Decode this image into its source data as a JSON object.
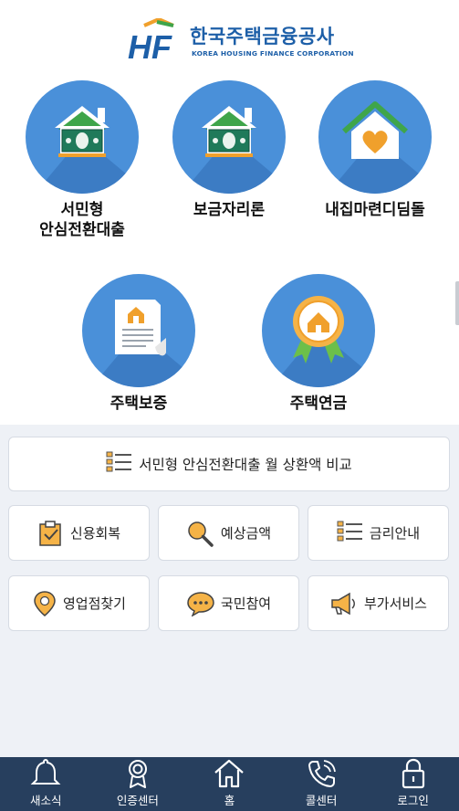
{
  "header": {
    "logo_mark": "HF",
    "logo_korean": "한국주택금융공사",
    "logo_english": "KOREA HOUSING FINANCE CORPORATION",
    "brand_blue": "#1d5fa8",
    "brand_orange": "#f0a02c",
    "brand_green": "#3fa54a"
  },
  "products": [
    {
      "label_line1": "서민형",
      "label_line2": "안심전환대출",
      "icon": "house-money-icon"
    },
    {
      "label_line1": "보금자리론",
      "icon": "house-money-icon"
    },
    {
      "label_line1": "내집마련디딤돌",
      "icon": "house-heart-icon"
    },
    {
      "label_line1": "주택보증",
      "icon": "document-house-icon"
    },
    {
      "label_line1": "주택연금",
      "icon": "award-house-icon"
    }
  ],
  "menu": {
    "compare": "서민형 안심전환대출 월 상환액 비교",
    "credit": "신용회복",
    "estimate": "예상금액",
    "rates": "금리안내",
    "branch": "영업점찾기",
    "participation": "국민참여",
    "extra": "부가서비스"
  },
  "nav": {
    "background": "#273f5e",
    "items": [
      {
        "label": "새소식",
        "icon": "bell-icon"
      },
      {
        "label": "인증센터",
        "icon": "certificate-icon"
      },
      {
        "label": "홈",
        "icon": "home-icon"
      },
      {
        "label": "콜센터",
        "icon": "phone-icon"
      },
      {
        "label": "로그인",
        "icon": "lock-icon"
      }
    ]
  }
}
